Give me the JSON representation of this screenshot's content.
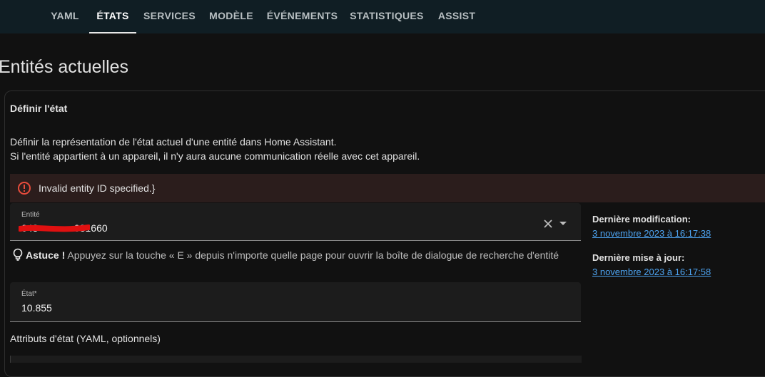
{
  "tabs": [
    {
      "label": "YAML",
      "active": false
    },
    {
      "label": "ÉTATS",
      "active": true
    },
    {
      "label": "SERVICES",
      "active": false
    },
    {
      "label": "MODÈLE",
      "active": false
    },
    {
      "label": "ÉVÉNEMENTS",
      "active": false
    },
    {
      "label": "STATISTIQUES",
      "active": false
    },
    {
      "label": "ASSIST",
      "active": false
    }
  ],
  "page_title": "Entités actuelles",
  "card": {
    "header": "Définir l'état",
    "description_line1": "Définir la représentation de l'état actuel d'une entité dans Home Assistant.",
    "description_line2": "Si l'entité appartient à un appareil, il n'y aura aucune communication réelle avec cet appareil."
  },
  "alert": {
    "message": "Invalid entity ID specified.}",
    "icon": "alert-circle-icon",
    "color": "#e74c3c"
  },
  "entity_field": {
    "label": "Entité",
    "value": "043             031660"
  },
  "tip": {
    "strong": "Astuce !",
    "text": "Appuyez sur la touche « E » depuis n'importe quelle page pour ouvrir la boîte de dialogue de recherche d'entité",
    "icon": "lightbulb-icon"
  },
  "state_field": {
    "label": "État*",
    "value": "10.855"
  },
  "attributes_label": "Attributs d'état (YAML, optionnels)",
  "side": {
    "last_changed_label": "Dernière modification:",
    "last_changed_value": "3 novembre 2023 à 16:17:38",
    "last_updated_label": "Dernière mise à jour:",
    "last_updated_value": "3 novembre 2023 à 16:17:58"
  },
  "colors": {
    "link": "#4da3f0",
    "error": "#e74c3c",
    "topbar": "#101e24"
  }
}
